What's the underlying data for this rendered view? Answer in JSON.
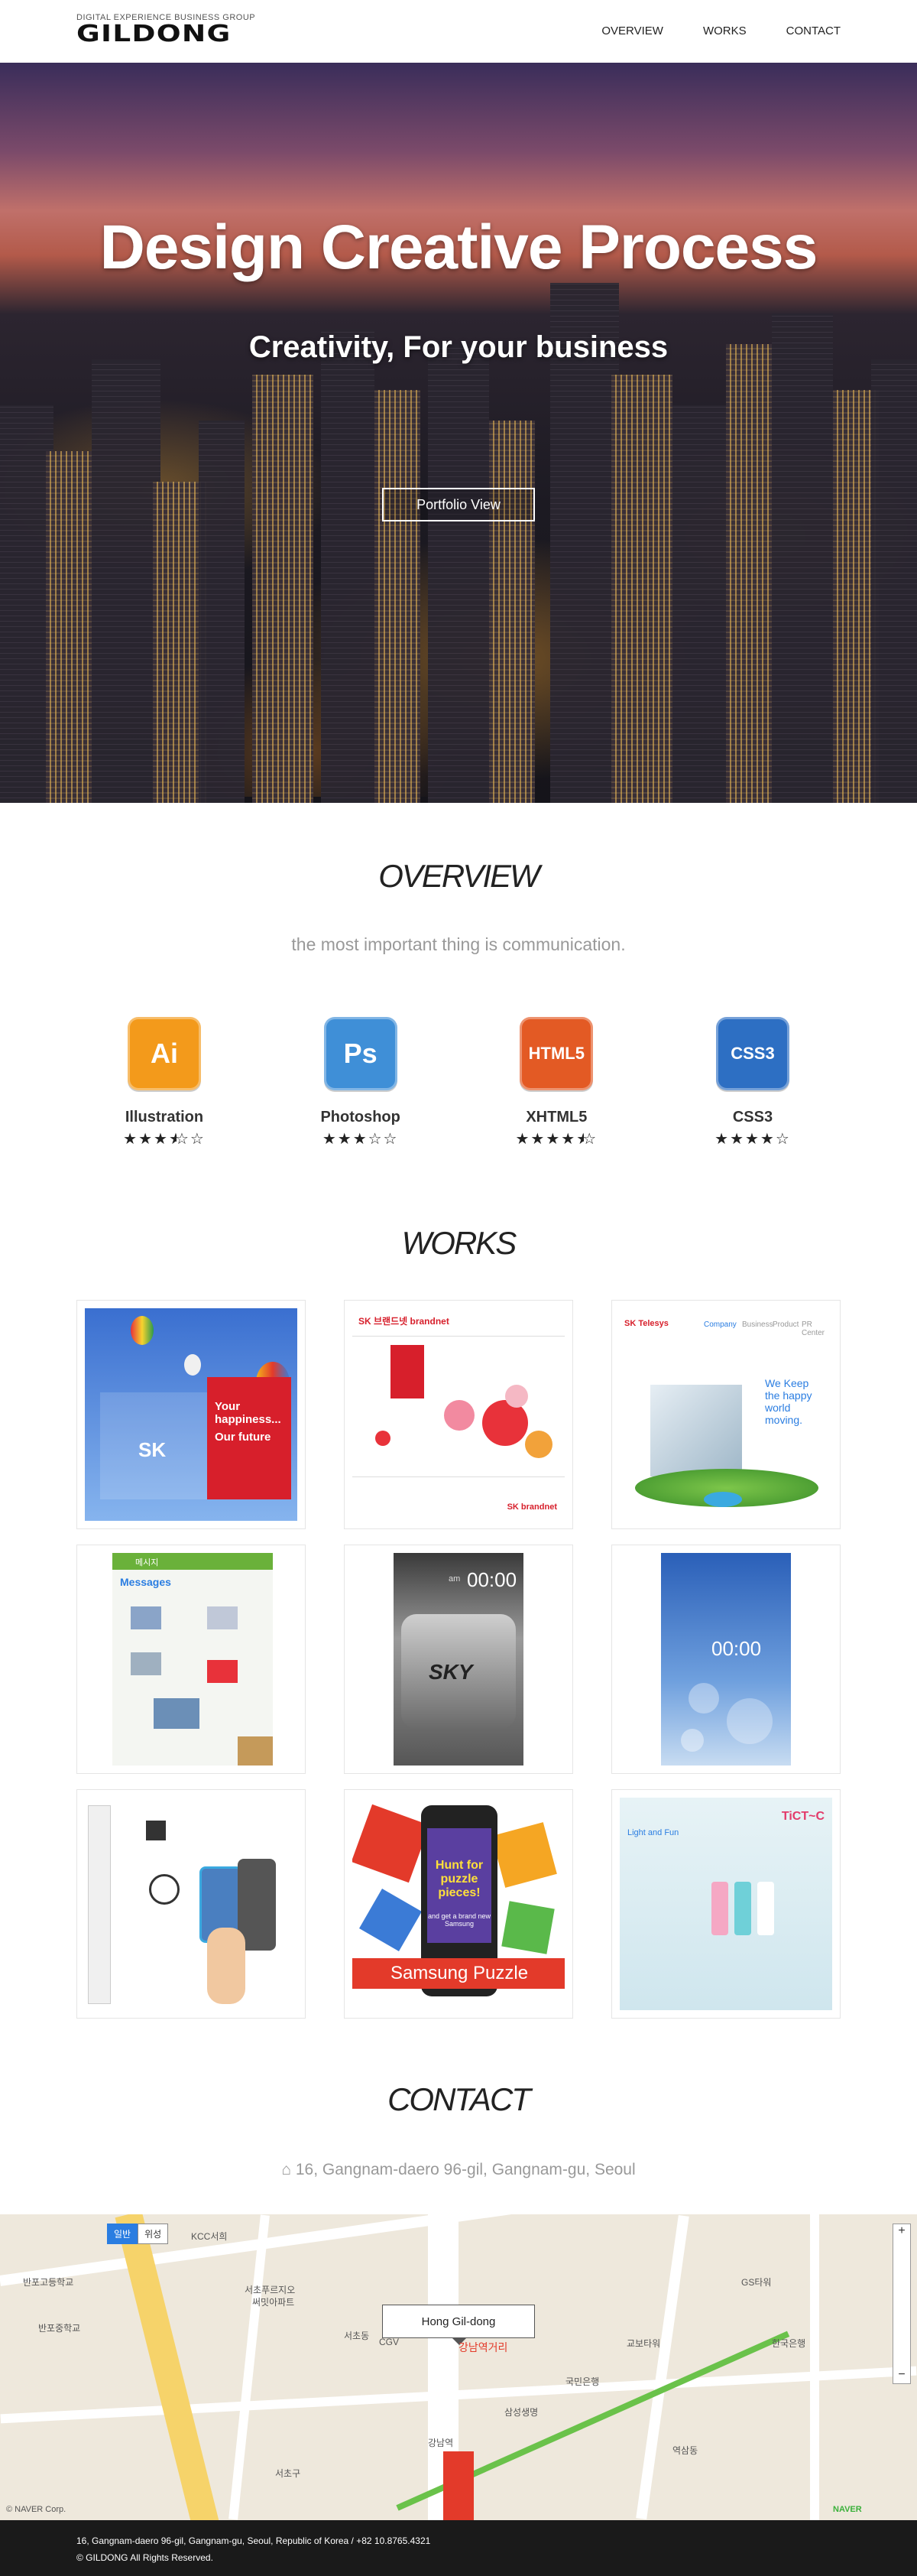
{
  "header": {
    "logo_sub": "DIGITAL EXPERIENCE BUSINESS GROUP",
    "logo_main": "GILDONG",
    "nav": [
      "OVERVIEW",
      "WORKS",
      "CONTACT"
    ]
  },
  "hero": {
    "title": "Design Creative Process",
    "subtitle": "Creativity, For your business",
    "button": "Portfolio View"
  },
  "overview": {
    "title": "OVERVIEW",
    "subtitle": "the most important thing is communication.",
    "skills": [
      {
        "icon": "Ai",
        "name": "Illustration",
        "stars": "★★★★☆",
        "rating": 3.5,
        "color": "#f39a1b"
      },
      {
        "icon": "Ps",
        "name": "Photoshop",
        "stars": "★★★☆☆",
        "rating": 3,
        "color": "#3f8fd7"
      },
      {
        "icon": "HTML5",
        "name": "XHTML5",
        "stars": "★★★★★",
        "rating": 4.5,
        "color": "#e35a24"
      },
      {
        "icon": "CSS3",
        "name": "CSS3",
        "stars": "★★★★☆",
        "rating": 4,
        "color": "#2d6fc3"
      }
    ]
  },
  "works": {
    "title": "WORKS",
    "items": [
      {
        "texts": [
          "Your happiness...",
          "Our future",
          "SK"
        ]
      },
      {
        "texts": [
          "SK 브랜드넷 brandnet",
          "SK brandnet"
        ]
      },
      {
        "texts": [
          "SK Telesys",
          "Company",
          "Business",
          "Product",
          "PR Center",
          "We Keep the happy world moving."
        ]
      },
      {
        "texts": [
          "메시지",
          "Messages"
        ]
      },
      {
        "texts": [
          "SKY",
          "00:00",
          "am"
        ]
      },
      {
        "texts": [
          "00:00"
        ]
      },
      {
        "texts": []
      },
      {
        "texts": [
          "Hunt for puzzle pieces!",
          "and get a brand new Samsung",
          "Samsung Puzzle"
        ]
      },
      {
        "texts": [
          "Light and Fun",
          "TiCT~C"
        ]
      }
    ]
  },
  "contact": {
    "title": "CONTACT",
    "address": "16, Gangnam-daero 96-gil, Gangnam-gu, Seoul",
    "map": {
      "pin_label": "Hong Gil-dong",
      "toggle_on": "일반",
      "toggle_off": "위성",
      "zoom_in": "+",
      "zoom_out": "−",
      "copyright": "© NAVER Corp.",
      "brand": "NAVER",
      "labels": [
        "KCC서희",
        "반포고등학교",
        "반포중학교",
        "서초푸르지오",
        "써밋아파트",
        "서초동",
        "CGV",
        "강남역거리",
        "국민은행",
        "삼성생명",
        "GS타워",
        "강남역",
        "교보타워",
        "서초구",
        "역삼동",
        "한국은행"
      ]
    }
  },
  "footer": {
    "line1": "16, Gangnam-daero 96-gil, Gangnam-gu, Seoul, Republic of Korea / +82 10.8765.4321",
    "line2": "© GILDONG All Rights Reserved."
  }
}
